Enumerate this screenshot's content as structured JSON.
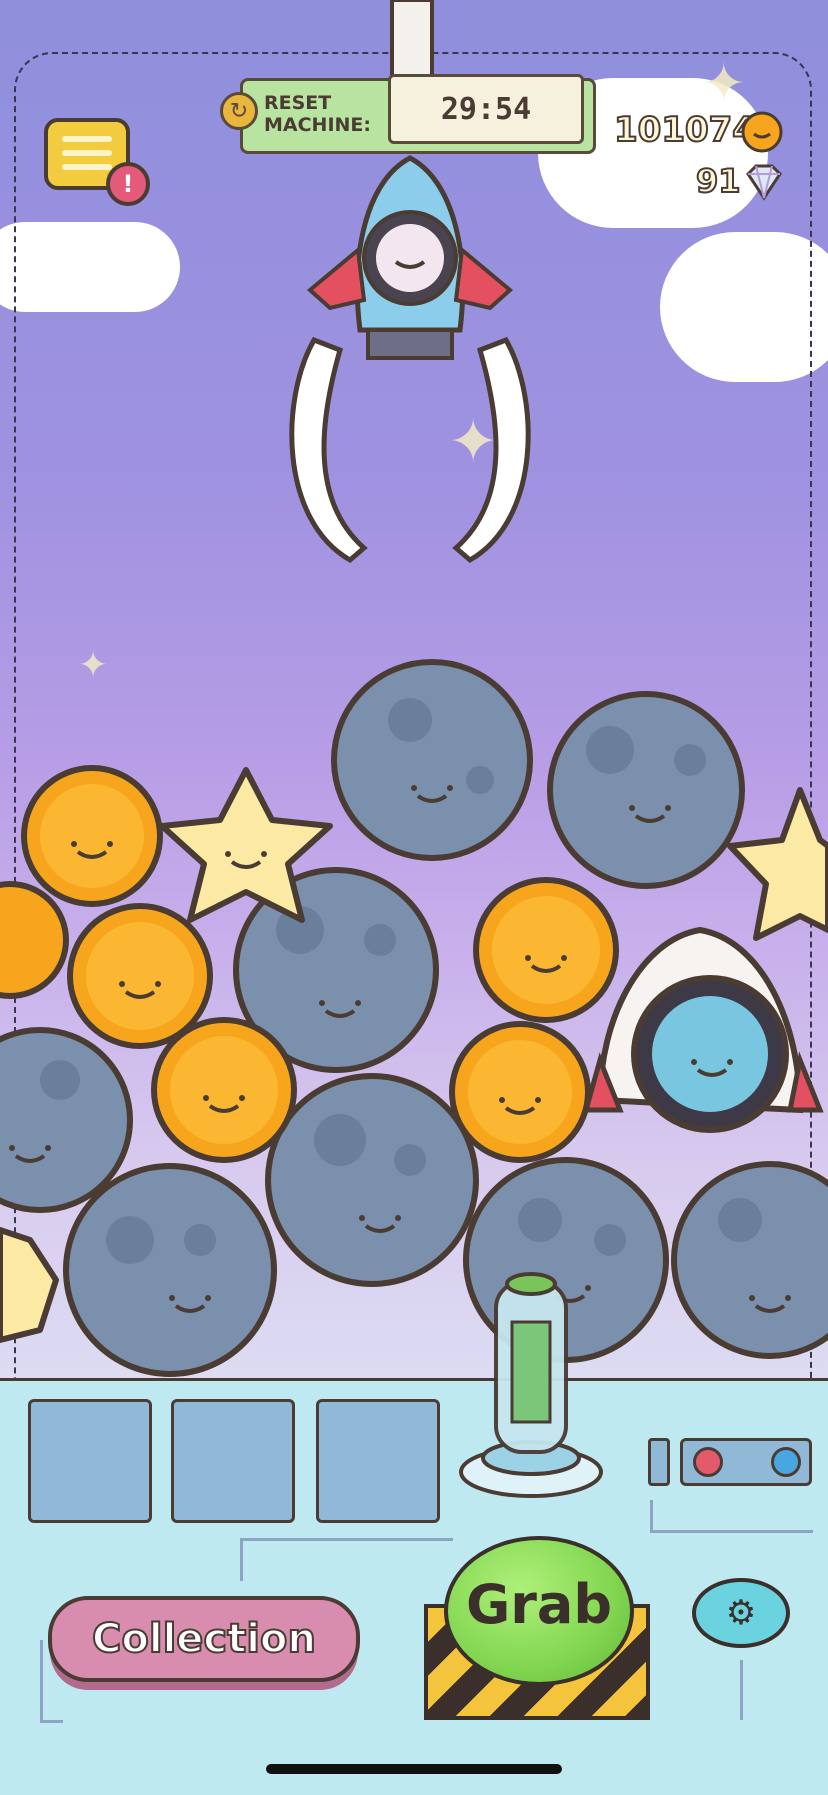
{
  "hud": {
    "reset_label_line1": "RESET",
    "reset_label_line2": "MACHINE:",
    "timer": "29:54",
    "coins": "101074",
    "gems": "91"
  },
  "buttons": {
    "collection": "Collection",
    "grab": "Grab"
  },
  "icons": {
    "menu": "menu-icon",
    "alert": "alert-icon",
    "reset": "reset-icon",
    "coin": "coin-icon",
    "gem": "diamond-icon",
    "settings": "gear-icon"
  },
  "colors": {
    "accent_grab": "#82d650",
    "collection": "#d88cae",
    "coin": "#f7a51c",
    "sky_top": "#8f8fdc",
    "panel": "#bfe9f1"
  }
}
